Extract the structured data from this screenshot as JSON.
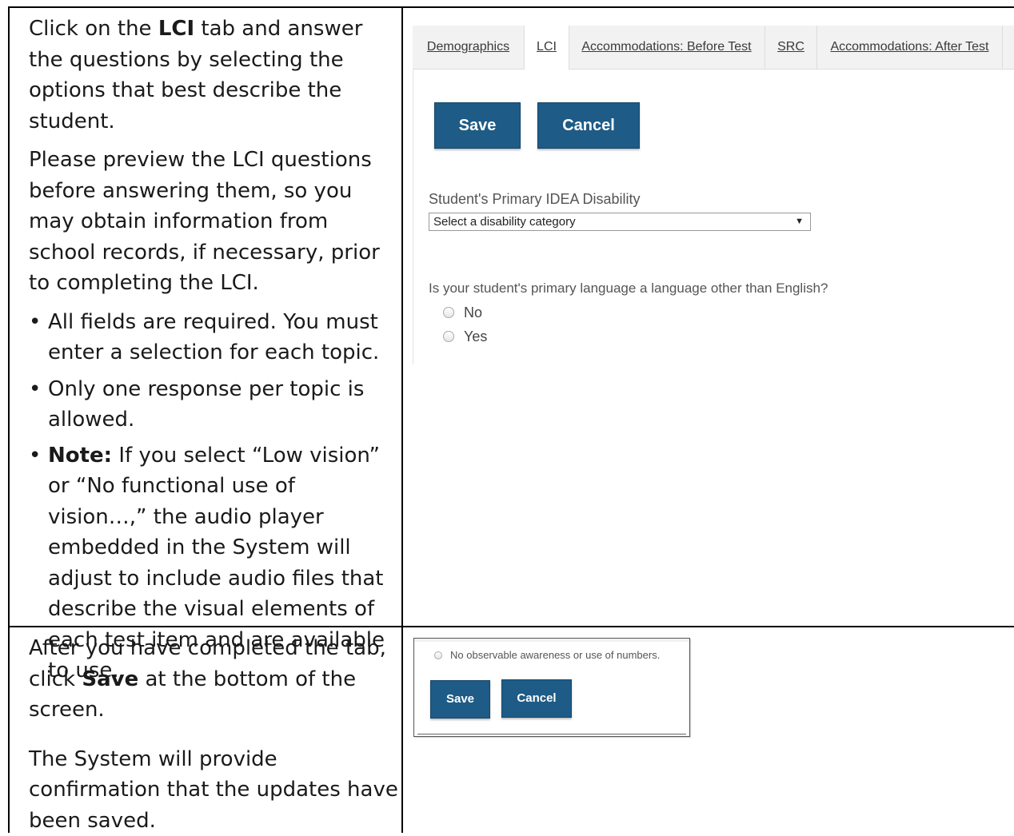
{
  "row1": {
    "para1_pre": "Click on the ",
    "para1_bold": "LCI",
    "para1_post": " tab and answer the questions by selecting the options that best describe the student.",
    "para2": "Please preview the LCI questions before answering them, so you may obtain information from school records, if necessary, prior to completing the LCI.",
    "bullet1": "All fields are required. You must enter a selection for each topic.",
    "bullet2": "Only one response per topic is allowed.",
    "bullet3_bold": "Note:",
    "bullet3_rest": " If you select “Low vision” or “No functional use of vision…,” the audio player embedded in the System will adjust to include audio files that describe the visual elements of each test item and are available to use."
  },
  "row2": {
    "para1_pre": "After you have completed the tab, click ",
    "para1_bold": "Save",
    "para1_post": " at the bottom of the screen.",
    "para2": "The System will provide confirmation that the updates have been saved."
  },
  "screenshot1": {
    "tabs": [
      "Demographics",
      "LCI",
      "Accommodations: Before Test",
      "SRC",
      "Accommodations: After Test"
    ],
    "active_tab": "LCI",
    "save_label": "Save",
    "cancel_label": "Cancel",
    "disability_label": "Student's Primary IDEA Disability",
    "disability_select_value": "Select a disability category",
    "language_question": "Is your student's primary language a language other than English?",
    "language_options": [
      "No",
      "Yes"
    ],
    "button_color": "#1e5b86"
  },
  "screenshot2": {
    "option_text": "No observable awareness or use of numbers.",
    "save_label": "Save",
    "cancel_label": "Cancel"
  }
}
